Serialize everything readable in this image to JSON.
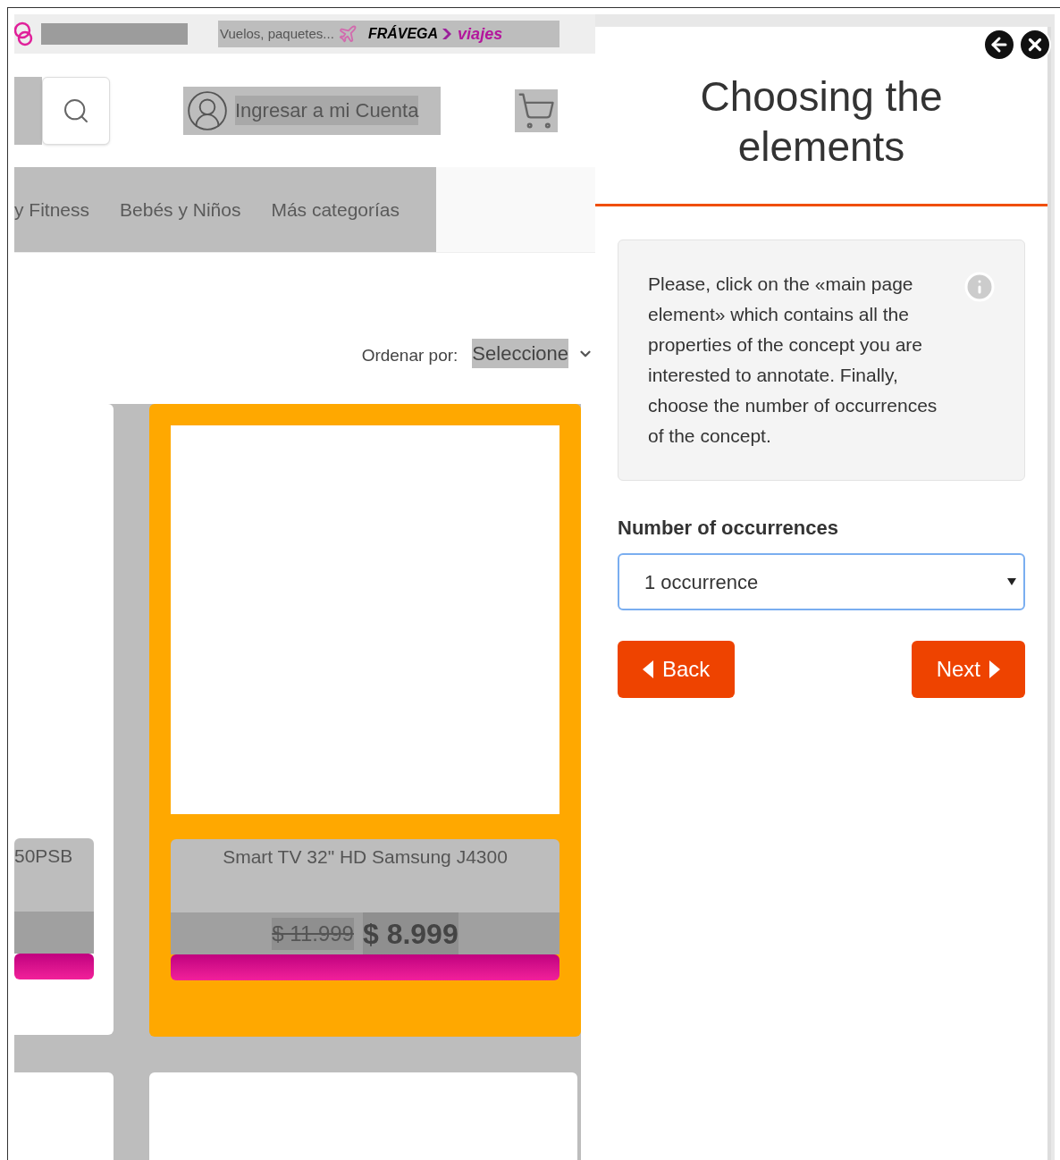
{
  "top_bar": {
    "promo_text": "Vuelos, paquetes...",
    "brand": "FRÁVEGA",
    "brand_suffix": "viajes"
  },
  "header": {
    "account_label": "Ingresar a mi Cuenta"
  },
  "nav": {
    "items": [
      "y Fitness",
      "Bebés y Niños",
      "Más categorías"
    ]
  },
  "sort": {
    "label": "Ordenar por:",
    "value": "Seleccione"
  },
  "products": [
    {
      "name": "50PSB",
      "highlighted": false
    },
    {
      "name": "Smart TV 32\" HD Samsung J4300",
      "old_price": "$ 11.999",
      "price": "$ 8.999",
      "highlighted": true
    }
  ],
  "panel": {
    "title": "Choosing the elements",
    "instructions": "Please, click on the «main page element» which contains all the properties of the concept you are interested to annotate. Finally, choose the number of occurrences of the concept.",
    "occurrences_label": "Number of occurrences",
    "occurrences_value": "1 occurrence",
    "buttons": [
      {
        "kind": "back",
        "label": "Back"
      },
      {
        "kind": "next",
        "label": "Next"
      }
    ]
  }
}
